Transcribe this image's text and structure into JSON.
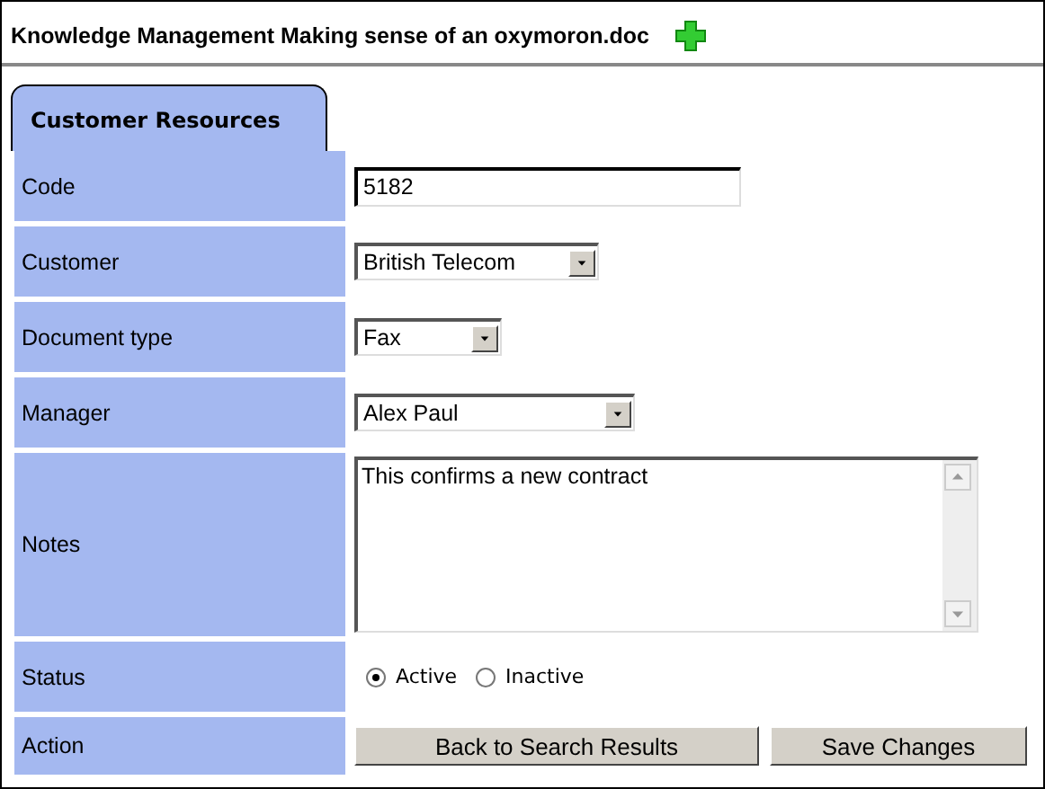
{
  "title": "Knowledge Management Making sense of an oxymoron.doc",
  "tabs": [
    {
      "label": "Customer Resources",
      "selected": true
    }
  ],
  "fields": [
    {
      "kind": "text",
      "label": "Code",
      "value": "5182"
    },
    {
      "kind": "select",
      "label": "Customer",
      "value": "British Telecom"
    },
    {
      "kind": "select",
      "label": "Document type",
      "value": "Fax"
    },
    {
      "kind": "select",
      "label": "Manager",
      "value": "Alex Paul"
    },
    {
      "kind": "textarea",
      "label": "Notes",
      "value": "This confirms a new contract"
    },
    {
      "kind": "radio",
      "label": "Status",
      "options": [
        {
          "label": "Active",
          "selected": true
        },
        {
          "label": "Inactive",
          "selected": false
        }
      ]
    },
    {
      "kind": "buttons",
      "label": "Action",
      "buttons": [
        "Back to Search Results",
        "Save Changes"
      ]
    }
  ]
}
